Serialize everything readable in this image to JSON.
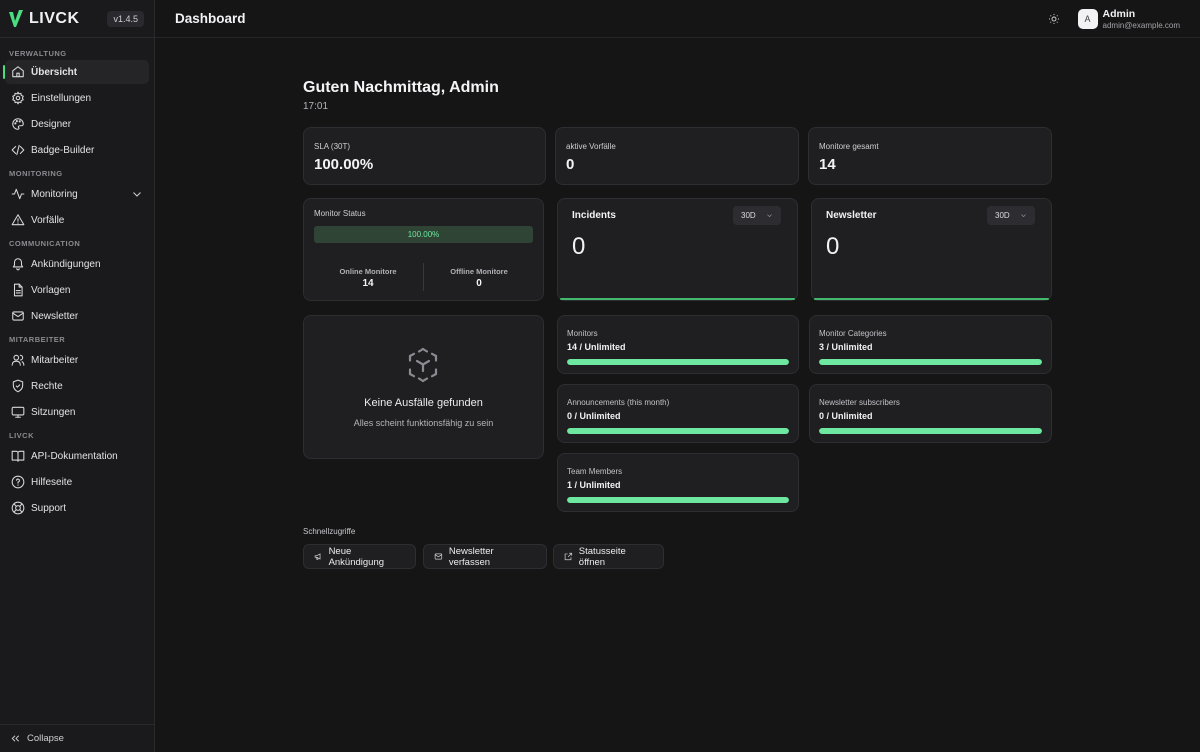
{
  "brand": {
    "name": "LIVCK",
    "version": "v1.4.5"
  },
  "sidebar": {
    "sections": [
      {
        "title": "VERWALTUNG",
        "items": [
          {
            "label": "Übersicht",
            "icon": "home-icon",
            "active": true
          },
          {
            "label": "Einstellungen",
            "icon": "gear-icon"
          },
          {
            "label": "Designer",
            "icon": "palette-icon"
          },
          {
            "label": "Badge-Builder",
            "icon": "code-icon"
          }
        ]
      },
      {
        "title": "MONITORING",
        "items": [
          {
            "label": "Monitoring",
            "icon": "activity-icon",
            "expandable": true
          },
          {
            "label": "Vorfälle",
            "icon": "warning-icon"
          }
        ]
      },
      {
        "title": "COMMUNICATION",
        "items": [
          {
            "label": "Ankündigungen",
            "icon": "bell-icon"
          },
          {
            "label": "Vorlagen",
            "icon": "file-icon"
          },
          {
            "label": "Newsletter",
            "icon": "mail-icon"
          }
        ]
      },
      {
        "title": "MITARBEITER",
        "items": [
          {
            "label": "Mitarbeiter",
            "icon": "users-icon"
          },
          {
            "label": "Rechte",
            "icon": "shield-icon"
          },
          {
            "label": "Sitzungen",
            "icon": "monitor-icon"
          }
        ]
      },
      {
        "title": "LIVCK",
        "items": [
          {
            "label": "API-Dokumentation",
            "icon": "book-icon"
          },
          {
            "label": "Hilfeseite",
            "icon": "help-icon"
          },
          {
            "label": "Support",
            "icon": "lifebuoy-icon"
          }
        ]
      }
    ],
    "collapse_label": "Collapse"
  },
  "header": {
    "title": "Dashboard",
    "user": {
      "initial": "A",
      "name": "Admin",
      "email": "admin@example.com"
    }
  },
  "main": {
    "greeting": "Guten Nachmittag, Admin",
    "time": "17:01",
    "stats": [
      {
        "label": "SLA (30T)",
        "value": "100.00%"
      },
      {
        "label": "aktive Vorfälle",
        "value": "0"
      },
      {
        "label": "Monitore gesamt",
        "value": "14"
      }
    ],
    "monitor_status": {
      "title": "Monitor Status",
      "percent_label": "100.00%",
      "percent": 100,
      "online_label": "Online Monitore",
      "online_value": "14",
      "offline_label": "Offline Monitore",
      "offline_value": "0"
    },
    "incidents": {
      "title": "Incidents",
      "range": "30D",
      "value": "0"
    },
    "newsletter": {
      "title": "Newsletter",
      "range": "30D",
      "value": "0"
    },
    "empty_state": {
      "title": "Keine Ausfälle gefunden",
      "subtitle": "Alles scheint funktionsfähig zu sein"
    },
    "usage": [
      {
        "label": "Monitors",
        "value": "14 / Unlimited",
        "fill": 100
      },
      {
        "label": "Monitor Categories",
        "value": "3 / Unlimited",
        "fill": 100
      },
      {
        "label": "Announcements (this month)",
        "value": "0 / Unlimited",
        "fill": 100
      },
      {
        "label": "Newsletter subscribers",
        "value": "0 / Unlimited",
        "fill": 100
      },
      {
        "label": "Team Members",
        "value": "1 / Unlimited",
        "fill": 100
      }
    ],
    "quick_access": {
      "title": "Schnellzugriffe",
      "buttons": [
        {
          "label": "Neue Ankündigung",
          "icon": "megaphone-icon"
        },
        {
          "label": "Newsletter verfassen",
          "icon": "mail-icon"
        },
        {
          "label": "Statusseite öffnen",
          "icon": "external-link-icon"
        }
      ]
    }
  },
  "colors": {
    "accent": "#4ade80",
    "background": "#151516",
    "card": "#1f1f22"
  }
}
